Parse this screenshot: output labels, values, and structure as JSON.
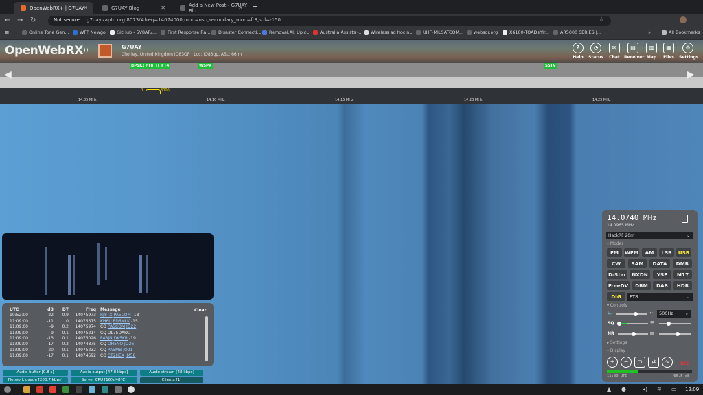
{
  "browser": {
    "tabs": [
      {
        "title": "OpenWebRX+ | G7UAY",
        "active": true
      },
      {
        "title": "G7UAY Blog",
        "active": false
      },
      {
        "title": "Add a New Post ‹ G7UAY Blo",
        "active": false
      }
    ],
    "not_secure": "Not secure",
    "url": "g7uay.zapto.org:8073/#freq=14074000,mod=usb,secondary_mod=ft8,sql=-150",
    "bookmarks": [
      "Online Tone Gen...",
      "WFP Newgo",
      "GitHub - 5V8AR/...",
      "First Response Ra...",
      "Disaster Connecti...",
      "Removal.AI: Uplo...",
      "Australia Assists -...",
      "Wireless ad hoc n...",
      "UHF-MILSATCOM...",
      "websdr.org",
      "X6100-TOADs/fir...",
      "AR5000 SERIES |..."
    ],
    "all_bookmarks": "All Bookmarks"
  },
  "header": {
    "logo": "OpenWebRX",
    "callsign": "G7UAY",
    "location": "Chorley, United Kingdom IO83QP | Loc: IO83qp, ASL: 66 m",
    "buttons": [
      "Help",
      "Status",
      "Chat",
      "Receiver",
      "Map",
      "Files",
      "Settings"
    ]
  },
  "spectrum": {
    "markers": [
      "BPSK31",
      "FT8",
      "JT",
      "FT4",
      "WSPR",
      "SSTV"
    ],
    "ticks": [
      "14.05 MHz",
      "14.10 MHz",
      "14.15 MHz",
      "14.20 MHz",
      "14.25 MHz"
    ],
    "passband_low": "0",
    "passband_high": "3000"
  },
  "messages": {
    "headers": [
      "UTC",
      "dB",
      "DT",
      "Freq",
      "Message"
    ],
    "clear": "Clear",
    "rows": [
      {
        "utc": "10:52:00",
        "db": "-22",
        "dt": "0.9",
        "freq": "14075973",
        "msg_a": "RJ8TX",
        "msg_b": "PA5COM",
        "msg_c": "-18"
      },
      {
        "utc": "11:09:00",
        "db": "-11",
        "dt": "0",
        "freq": "14075375",
        "msg_a": "KH6U",
        "msg_b": "PD6MLK",
        "msg_c": "-15"
      },
      {
        "utc": "11:09:00",
        "db": "-9",
        "dt": "0.2",
        "freq": "14075974",
        "msg_a": "CQ",
        "msg_b": "PA5COM",
        "msg_c": "JO22"
      },
      {
        "utc": "11:09:00",
        "db": "-9",
        "dt": "0.1",
        "freq": "14075214",
        "msg_a": "CQ",
        "msg_b": "DL75DARC",
        "msg_c": ""
      },
      {
        "utc": "11:09:00",
        "db": "-13",
        "dt": "0.1",
        "freq": "14075026",
        "msg_a": "F4BJN",
        "msg_b": "DK5KR",
        "msg_c": "-19"
      },
      {
        "utc": "11:09:00",
        "db": "-17",
        "dt": "0.2",
        "freq": "14074875",
        "msg_a": "CQ",
        "msg_b": "OH5NQ",
        "msg_c": "JO26"
      },
      {
        "utc": "11:09:00",
        "db": "-20",
        "dt": "0.1",
        "freq": "14075232",
        "msg_a": "CQ",
        "msg_b": "PA5MB",
        "msg_c": "JO21"
      },
      {
        "utc": "11:09:00",
        "db": "-17",
        "dt": "0.1",
        "freq": "14074592",
        "msg_a": "CQ",
        "msg_b": "CT2HEX",
        "msg_c": "IM58"
      }
    ]
  },
  "status": {
    "audio_buffer": "Audio buffer [0.8 s]",
    "audio_output": "Audio output [47.8 kbps]",
    "audio_stream": "Audio stream [48 kbps]",
    "network": "Network usage [200.7 kbps]",
    "cpu": "Server CPU [16%/48°C]",
    "clients": "Clients [1]"
  },
  "receiver": {
    "frequency": "14.0740 MHz",
    "sub_frequency": "14.0965 MHz",
    "profile": "HackRF 20m",
    "modes_label": "Modes",
    "modes": [
      [
        "FM",
        "WFM",
        "AM",
        "LSB",
        "USB"
      ],
      [
        "CW",
        "SAM",
        "DATA",
        "DMR"
      ],
      [
        "D-Star",
        "NXDN",
        "YSF",
        "M17"
      ],
      [
        "FreeDV",
        "DRM",
        "DAB",
        "HDR"
      ]
    ],
    "active_mode": "USB",
    "dig_label": "DIG",
    "dig_mode": "FT8",
    "controls_label": "Controls",
    "bandwidth": "500Hz",
    "sq": "SQ",
    "nr": "NR",
    "settings_label": "Settings",
    "display_label": "Display",
    "rec": "REC",
    "clock": "11:09 UTC",
    "level": "-66.5 dB"
  },
  "taskbar": {
    "time": "12:09"
  }
}
